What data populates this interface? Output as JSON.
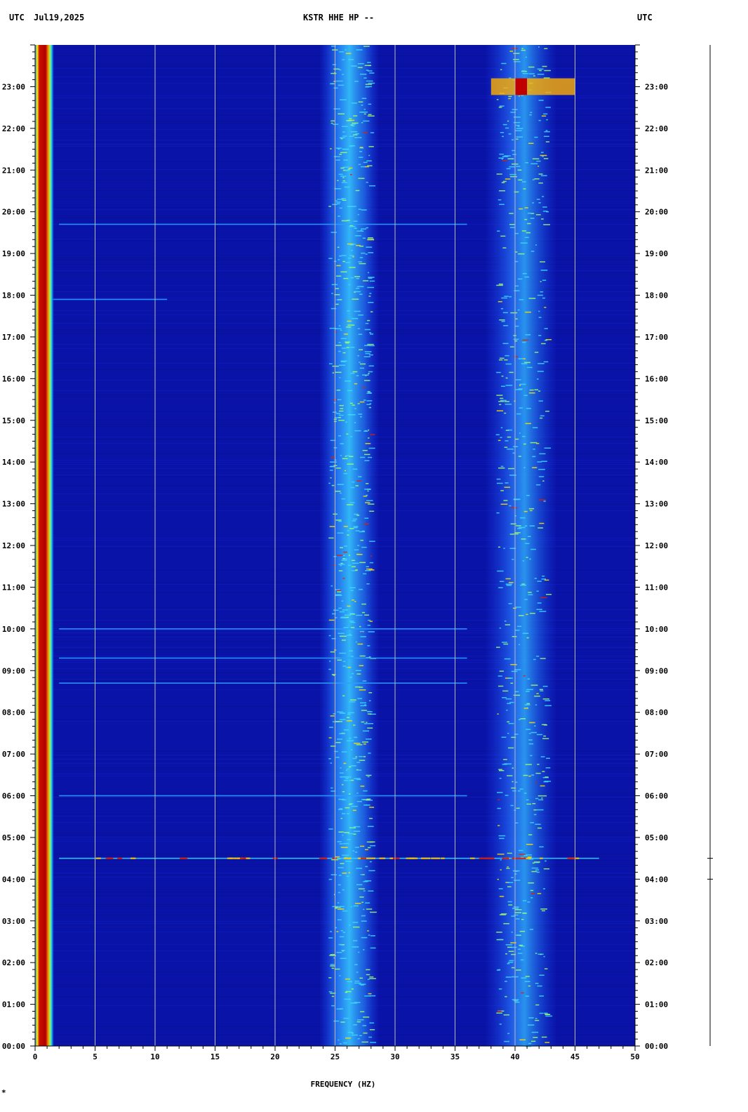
{
  "header": {
    "left_tz": "UTC",
    "date": "Jul19,2025",
    "station": "KSTR HHE HP --",
    "right_tz": "UTC"
  },
  "footer_mark": "*",
  "chart_data": {
    "type": "heatmap",
    "title": "KSTR HHE HP --",
    "xlabel": "FREQUENCY (HZ)",
    "ylabel": "UTC",
    "xlim": [
      0,
      50
    ],
    "ylim_hours": [
      0,
      24
    ],
    "x_ticks": [
      0,
      5,
      10,
      15,
      20,
      25,
      30,
      35,
      40,
      45,
      50
    ],
    "x_tick_labels": [
      "0",
      "5",
      "10",
      "15",
      "20",
      "25",
      "30",
      "35",
      "40",
      "45",
      "50"
    ],
    "y_ticks_hours": [
      0,
      1,
      2,
      3,
      4,
      5,
      6,
      7,
      8,
      9,
      10,
      11,
      12,
      13,
      14,
      15,
      16,
      17,
      18,
      19,
      20,
      21,
      22,
      23
    ],
    "y_tick_labels": [
      "00:00",
      "01:00",
      "02:00",
      "03:00",
      "04:00",
      "05:00",
      "06:00",
      "07:00",
      "08:00",
      "09:00",
      "10:00",
      "11:00",
      "12:00",
      "13:00",
      "14:00",
      "15:00",
      "16:00",
      "17:00",
      "18:00",
      "19:00",
      "20:00",
      "21:00",
      "22:00",
      "23:00"
    ],
    "gridlines_x": [
      5,
      10,
      15,
      20,
      25,
      30,
      35,
      40,
      45
    ],
    "grid": true,
    "colormap": [
      "#00007f",
      "#0000d0",
      "#1a40ff",
      "#00c8ff",
      "#a8ff55",
      "#ffea00",
      "#ff5500",
      "#a00000"
    ],
    "background_color": "#0a13a8",
    "energy_bands_hz": [
      {
        "center": 0.5,
        "width": 1.2,
        "level": "very high"
      },
      {
        "center": 26.2,
        "width": 2.5,
        "level": "moderate"
      },
      {
        "center": 40.5,
        "width": 3.0,
        "level": "moderate"
      }
    ],
    "broadband_events_hours": [
      4.5,
      17.9,
      19.7,
      9.3,
      10.0,
      6.0,
      8.7
    ],
    "high_energy_patch": {
      "freq_range_hz": [
        38,
        45
      ],
      "hour_range": [
        22.8,
        23.2
      ]
    }
  }
}
